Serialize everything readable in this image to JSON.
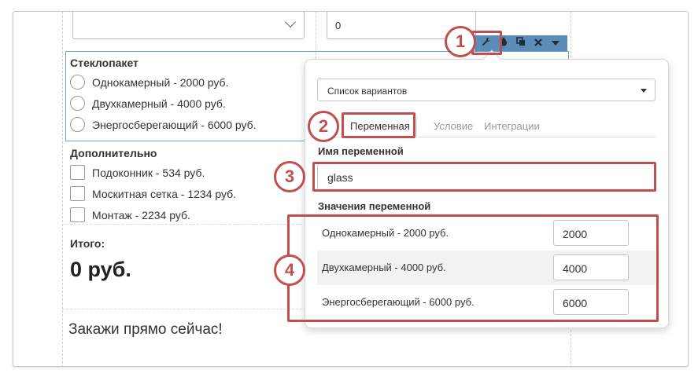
{
  "top": {
    "number_value": "0"
  },
  "glass": {
    "title": "Стеклопакет",
    "options": [
      "Однокамерный - 2000 руб.",
      "Двухкамерный - 4000 руб.",
      "Энергосберегающий - 6000 руб."
    ]
  },
  "extra": {
    "title": "Дополнительно",
    "options": [
      "Подоконник - 534 руб.",
      "Москитная сетка - 1234 руб.",
      "Монтаж - 2234 руб."
    ]
  },
  "total": {
    "label": "Итого:",
    "value": "0 руб."
  },
  "order_text": "Закажи прямо сейчас!",
  "toolbar": {
    "icons": [
      "wrench-icon",
      "drop-icon",
      "copy-icon",
      "close-icon",
      "caret-down-icon"
    ]
  },
  "popover": {
    "field_type": "Список вариантов",
    "tabs": [
      "Переменная",
      "Условие",
      "Интеграции"
    ],
    "var_name_label": "Имя переменной",
    "var_name_value": "glass",
    "values_label": "Значения переменной",
    "values": [
      {
        "label": "Однокамерный - 2000 руб.",
        "value": "2000"
      },
      {
        "label": "Двухкамерный - 4000 руб.",
        "value": "4000"
      },
      {
        "label": "Энергосберегающий - 6000 руб.",
        "value": "6000"
      }
    ]
  },
  "callouts": [
    "1",
    "2",
    "3",
    "4"
  ],
  "colors": {
    "highlight": "#c0504d",
    "toolbar": "#5b8db8",
    "selected_border": "#6aa3cf"
  }
}
